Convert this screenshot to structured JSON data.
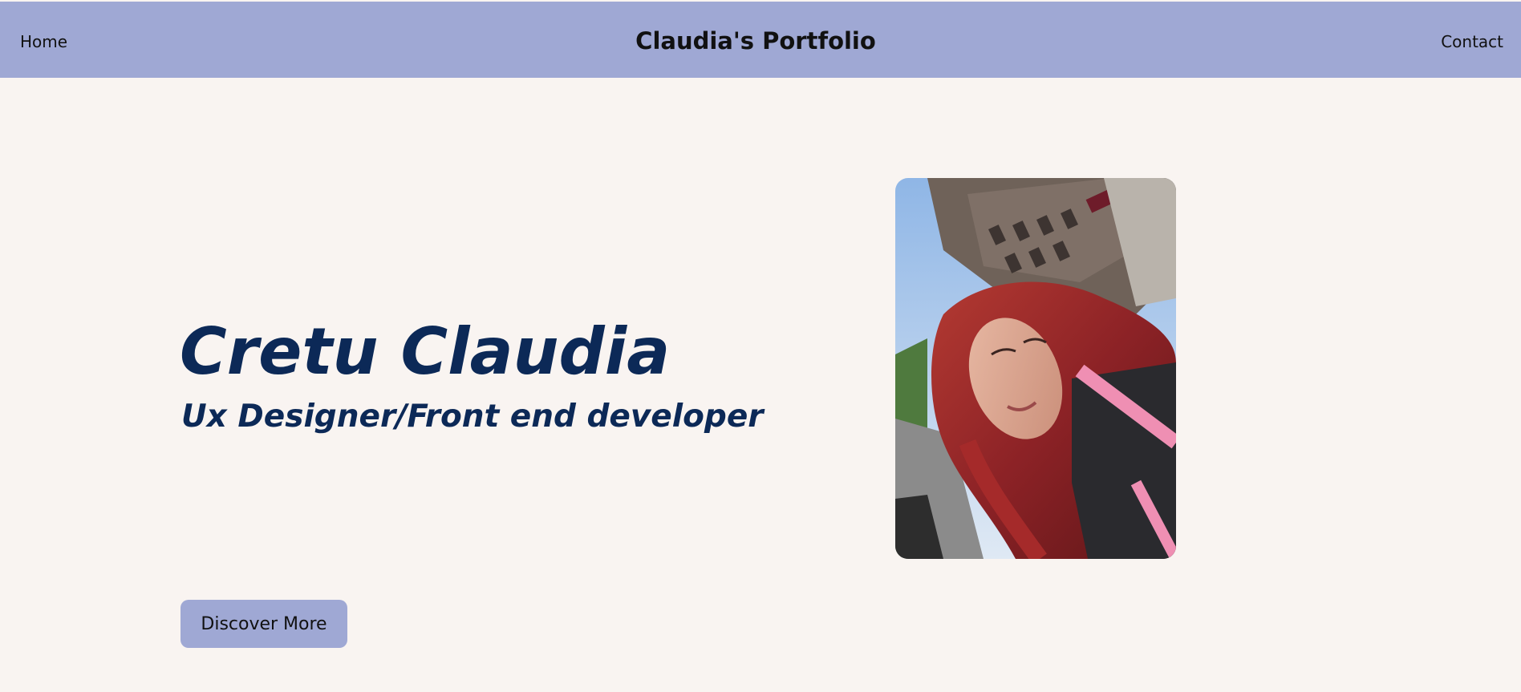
{
  "navbar": {
    "home_label": "Home",
    "brand": "Claudia's Portfolio",
    "contact_label": "Contact",
    "background": "#9fa8d4"
  },
  "hero": {
    "name": "Cretu Claudia",
    "role": "Ux Designer/Front end developer",
    "cta_label": "Discover More",
    "text_color": "#0c2957"
  },
  "profile_photo": {
    "subject": "selfie of a woman with long red hair on a city street"
  },
  "page": {
    "background": "#f9f4f1"
  }
}
